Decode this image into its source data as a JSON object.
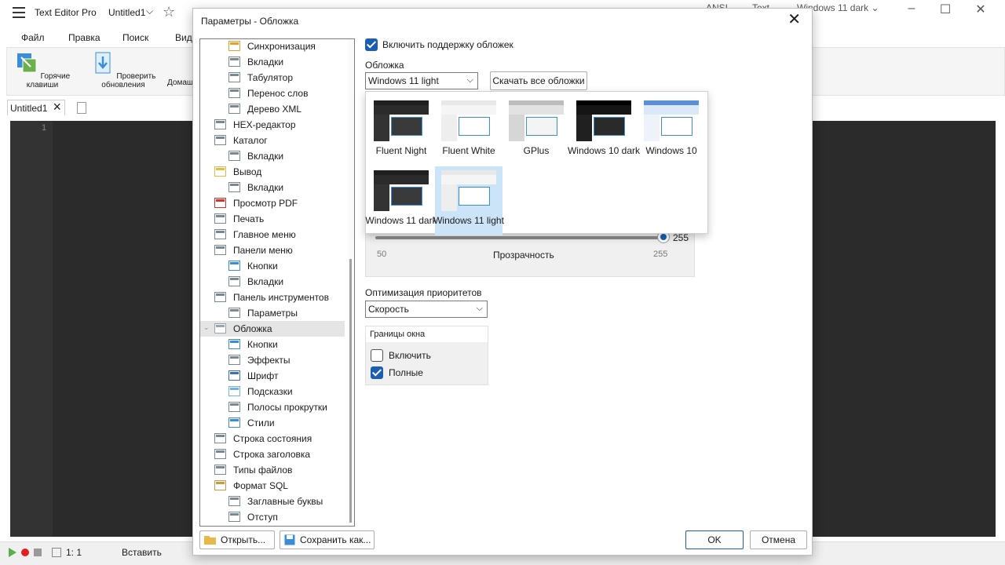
{
  "app": {
    "title": "Text Editor Pro",
    "document": "Untitled1",
    "encoding": "ANSI",
    "syntax": "Text",
    "skin": "Windows 11 dark"
  },
  "menu": [
    "Файл",
    "Правка",
    "Поиск",
    "Вид"
  ],
  "ribbon": [
    {
      "label": "Горячие клавиши",
      "icon": "hotkeys-icon"
    },
    {
      "label": "Проверить обновления",
      "icon": "update-icon"
    },
    {
      "label": "Домаш",
      "icon": "home-icon"
    }
  ],
  "editor": {
    "tab_label": "Untitled1",
    "line_number": "1"
  },
  "status": {
    "position": "1: 1",
    "mode": "Вставить"
  },
  "dialog": {
    "title": "Параметры  -  Обложка",
    "tree": [
      {
        "label": "Синхронизация",
        "level": 1,
        "icon": "sync-icon"
      },
      {
        "label": "Вкладки",
        "level": 1,
        "icon": "tabs-icon"
      },
      {
        "label": "Табулятор",
        "level": 1,
        "icon": "tabulator-icon"
      },
      {
        "label": "Перенос слов",
        "level": 1,
        "icon": "word-wrap-icon"
      },
      {
        "label": "Дерево XML",
        "level": 1,
        "icon": "xml-tree-icon"
      },
      {
        "label": "HEX-редактор",
        "level": 0,
        "icon": "hex-icon"
      },
      {
        "label": "Каталог",
        "level": 0,
        "icon": "catalog-icon"
      },
      {
        "label": "Вкладки",
        "level": 1,
        "icon": "tabs-icon"
      },
      {
        "label": "Вывод",
        "level": 0,
        "icon": "output-folder-icon"
      },
      {
        "label": "Вкладки",
        "level": 1,
        "icon": "tabs-icon"
      },
      {
        "label": "Просмотр PDF",
        "level": 0,
        "icon": "pdf-icon"
      },
      {
        "label": "Печать",
        "level": 0,
        "icon": "printer-icon"
      },
      {
        "label": "Главное меню",
        "level": 0,
        "icon": "main-menu-icon"
      },
      {
        "label": "Панели меню",
        "level": 0,
        "icon": "menu-panels-icon"
      },
      {
        "label": "Кнопки",
        "level": 1,
        "icon": "buttons-icon"
      },
      {
        "label": "Вкладки",
        "level": 1,
        "icon": "tabs-icon"
      },
      {
        "label": "Панель инструментов",
        "level": 0,
        "icon": "toolbar-icon"
      },
      {
        "label": "Параметры",
        "level": 1,
        "icon": "options-icon"
      },
      {
        "label": "Обложка",
        "level": 0,
        "icon": "skin-icon",
        "selected": true,
        "expanded": true
      },
      {
        "label": "Кнопки",
        "level": 1,
        "icon": "buttons-icon"
      },
      {
        "label": "Эффекты",
        "level": 1,
        "icon": "effects-icon"
      },
      {
        "label": "Шрифт",
        "level": 1,
        "icon": "font-icon"
      },
      {
        "label": "Подсказки",
        "level": 1,
        "icon": "tooltip-icon"
      },
      {
        "label": "Полосы прокрутки",
        "level": 1,
        "icon": "scrollbars-icon"
      },
      {
        "label": "Стили",
        "level": 1,
        "icon": "styles-icon"
      },
      {
        "label": "Строка состояния",
        "level": 0,
        "icon": "statusbar-icon"
      },
      {
        "label": "Строка заголовка",
        "level": 0,
        "icon": "titlebar-icon"
      },
      {
        "label": "Типы файлов",
        "level": 0,
        "icon": "file-types-icon"
      },
      {
        "label": "Формат SQL",
        "level": 0,
        "icon": "sql-format-icon"
      },
      {
        "label": "Заглавные буквы",
        "level": 1,
        "icon": "capitals-icon"
      },
      {
        "label": "Отступ",
        "level": 1,
        "icon": "indent-icon"
      }
    ],
    "enable_skins": {
      "label": "Включить поддержку обложек",
      "checked": true
    },
    "skin_label": "Обложка",
    "skin_value": "Windows 11 light",
    "download_button": "Скачать все обложки",
    "skins": [
      {
        "name": "Fluent Night",
        "theme": "dark"
      },
      {
        "name": "Fluent White",
        "theme": "light"
      },
      {
        "name": "GPlus",
        "theme": "gray"
      },
      {
        "name": "Windows 10 dark",
        "theme": "black"
      },
      {
        "name": "Windows 10",
        "theme": "blue"
      },
      {
        "name": "Windows 11 dark",
        "theme": "dark"
      },
      {
        "name": "Windows 11 light",
        "theme": "light",
        "selected": true
      }
    ],
    "transparency": {
      "label": "Прозрачность",
      "value": "255",
      "min": "50",
      "max": "255"
    },
    "priority": {
      "label": "Оптимизация приоритетов",
      "value": "Скорость"
    },
    "borders": {
      "title": "Границы окна",
      "enable": {
        "label": "Включить",
        "checked": false
      },
      "full": {
        "label": "Полные",
        "checked": true
      }
    },
    "open_button": "Открыть...",
    "save_button": "Сохранить как...",
    "ok_button": "OK",
    "cancel_button": "Отмена"
  },
  "colors": {
    "accent": "#1a5fb4",
    "editor_bg": "#2b2b2b",
    "selection": "#cce4f7"
  }
}
